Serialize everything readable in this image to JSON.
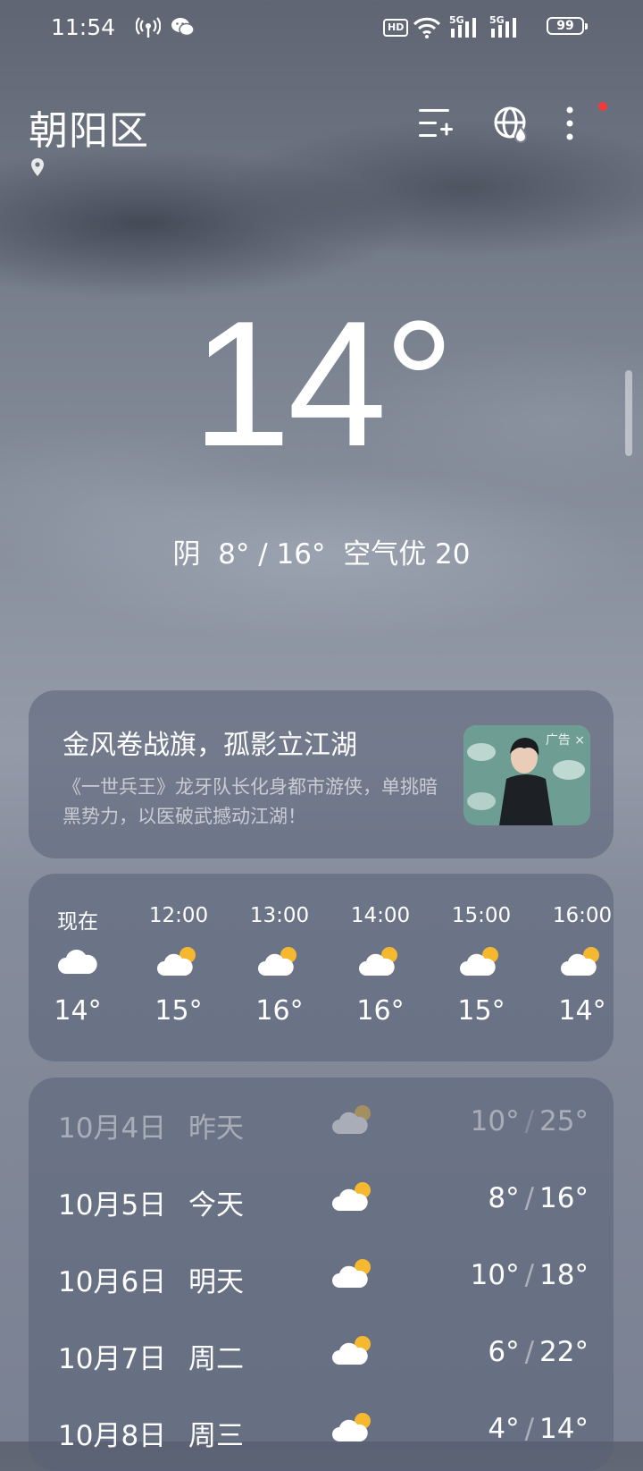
{
  "status_bar": {
    "time": "11:54",
    "hd_label": "HD",
    "network_1": "5G",
    "network_2": "5G",
    "battery": "99"
  },
  "header": {
    "city": "朝阳区"
  },
  "current": {
    "temperature": "14°",
    "summary": "阴  8° / 16°  空气优 20"
  },
  "ad": {
    "title": "金风卷战旗，孤影立江湖",
    "description": "《一世兵王》龙牙队长化身都市游侠，单挑暗黑势力，以医破武撼动江湖！",
    "tag": "广告 ×"
  },
  "hourly": [
    {
      "label": "现在",
      "temp": "14°",
      "icon": "cloudy"
    },
    {
      "label": "12:00",
      "temp": "15°",
      "icon": "partly-cloudy"
    },
    {
      "label": "13:00",
      "temp": "16°",
      "icon": "partly-cloudy"
    },
    {
      "label": "14:00",
      "temp": "16°",
      "icon": "partly-cloudy"
    },
    {
      "label": "15:00",
      "temp": "15°",
      "icon": "partly-cloudy"
    },
    {
      "label": "16:00",
      "temp": "14°",
      "icon": "partly-cloudy"
    }
  ],
  "daily": [
    {
      "date": "10月4日",
      "day": "昨天",
      "low": "10°",
      "high": "25°",
      "icon": "partly-cloudy",
      "past": true
    },
    {
      "date": "10月5日",
      "day": "今天",
      "low": "8°",
      "high": "16°",
      "icon": "partly-cloudy",
      "past": false
    },
    {
      "date": "10月6日",
      "day": "明天",
      "low": "10°",
      "high": "18°",
      "icon": "partly-cloudy",
      "past": false
    },
    {
      "date": "10月7日",
      "day": "周二",
      "low": "6°",
      "high": "22°",
      "icon": "partly-cloudy",
      "past": false
    },
    {
      "date": "10月8日",
      "day": "周三",
      "low": "4°",
      "high": "14°",
      "icon": "partly-cloudy",
      "past": false
    }
  ],
  "colors": {
    "sun": "#f5b82e",
    "notification_dot": "#f23a3a"
  }
}
